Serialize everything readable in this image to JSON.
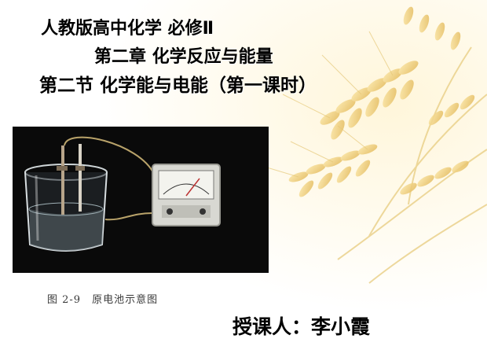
{
  "slide": {
    "title_line1": "人教版高中化学 必修Ⅱ",
    "title_line2": "第二章 化学反应与能量",
    "title_line3": "第二节 化学能与电能（第一课时）",
    "figure_caption": "图 2-9　原电池示意图",
    "author": "授课人：李小霞"
  },
  "colors": {
    "text": "#000000",
    "wheat": "#e8c56a",
    "photo_background": "#0a0a0a",
    "caption": "#3a3a3a"
  }
}
